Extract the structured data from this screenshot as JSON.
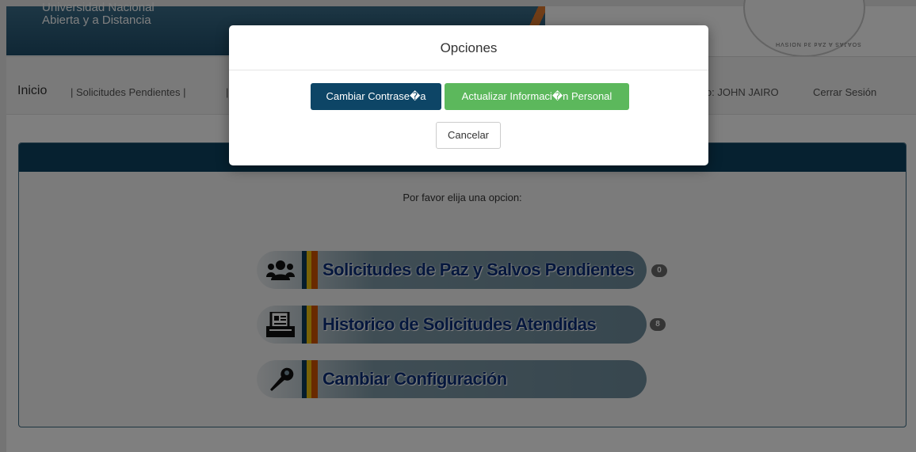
{
  "header": {
    "brand_line1": "Universidad Nacional",
    "brand_line2": "Abierta y a Distancia",
    "seal_text": "SOAJAS A ZAd 3d NOISVH"
  },
  "nav": {
    "home": "Inicio",
    "pending": "| Solicitudes Pendientes |",
    "partial": "|",
    "user": "io: JOHN JAIRO",
    "logout": "Cerrar Sesión"
  },
  "panel": {
    "prompt": "Por favor elija una opcion:",
    "options": [
      {
        "label": "Solicitudes de Paz y Salvos Pendientes",
        "icon": "users-icon",
        "count": "0"
      },
      {
        "label": "Historico de Solicitudes Atendidas",
        "icon": "archive-icon",
        "count": "8"
      },
      {
        "label": "Cambiar Configuración",
        "icon": "wrench-icon"
      }
    ]
  },
  "modal": {
    "title": "Opciones",
    "change_password": "Cambiar Contrase�a",
    "update_info": "Actualizar Informaci�n Personal",
    "cancel": "Cancelar"
  },
  "colors": {
    "primary": "#0d4566",
    "success": "#5cb85c",
    "panel_head": "#0d4261",
    "option_text": "#0a2f7a"
  }
}
